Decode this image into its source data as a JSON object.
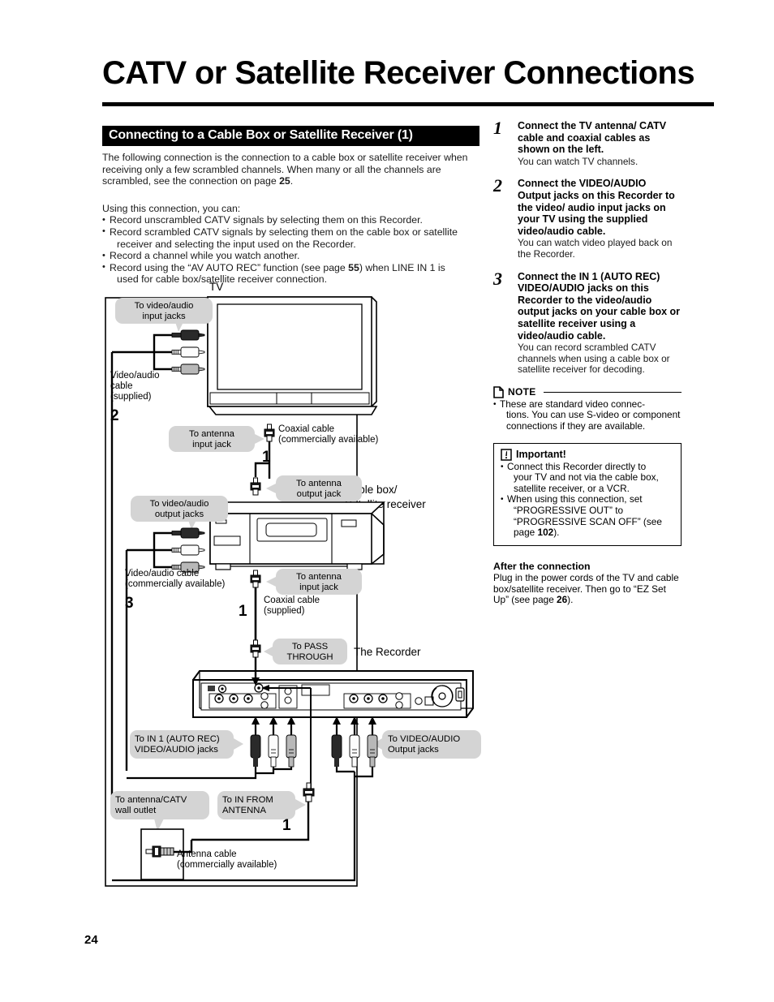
{
  "document": {
    "title": "CATV or Satellite Receiver Connections",
    "page_number": "24"
  },
  "section": {
    "heading": "Connecting to a Cable Box or Satellite Receiver (1)",
    "intro_1": "The following connection is the connection to a cable box or satellite receiver when receiving only a few scrambled channels. When many or all the channels are scrambled, see the connection on page ",
    "intro_1_page": "25",
    "intro_1_end": ".",
    "using_lead": "Using this connection, you can:",
    "bullets": [
      {
        "text": "Record unscrambled CATV signals by selecting them on this Recorder."
      },
      {
        "text": "Record scrambled CATV signals by selecting them on the cable box or satellite",
        "cont": "receiver and selecting the input used on the Recorder."
      },
      {
        "text": "Record a channel while you watch another."
      },
      {
        "pre": "Record using the “AV AUTO REC” function (see page ",
        "bold": "55",
        "post": ") when LINE IN 1 is",
        "cont": "used for cable box/satellite receiver connection."
      }
    ]
  },
  "steps": [
    {
      "number": "1",
      "heading": "Connect the TV antenna/ CATV cable and coaxial cables as shown on the left.",
      "sub": "You can watch TV channels."
    },
    {
      "number": "2",
      "heading": "Connect the VIDEO/AUDIO Output jacks on this Recorder to the video/ audio input jacks on your TV using the supplied video/audio cable.",
      "sub": "You can watch video played back on the Recorder."
    },
    {
      "number": "3",
      "heading": "Connect the IN 1 (AUTO REC) VIDEO/AUDIO jacks on this Recorder to the video/audio output jacks on your cable box or satellite receiver using a video/audio cable.",
      "sub": "You can record scrambled CATV channels when using a cable box or satellite receiver for decoding."
    }
  ],
  "note": {
    "label": "NOTE",
    "icon": "document-icon",
    "bullets": [
      {
        "text": "These are standard video connec-",
        "cont": "tions. You can use S-video or component connections if they are available."
      }
    ]
  },
  "important": {
    "label": "Important!",
    "icon": "exclamation-icon",
    "bullets": [
      {
        "text": "Connect this Recorder directly to",
        "cont": "your TV and not via the cable box, satellite receiver, or a VCR."
      },
      {
        "pre": "When using this connection, set",
        "cont_pre": "“PROGRESSIVE OUT” to “PROGRESSIVE SCAN OFF” (see page ",
        "bold": "102",
        "post": ")."
      }
    ]
  },
  "after": {
    "heading": "After the connection",
    "body_pre": "Plug in the power cords of the TV and cable box/satellite receiver. Then go to “EZ Set Up” (see page ",
    "body_bold": "26",
    "body_post": ")."
  },
  "diagram": {
    "devices": {
      "tv": "TV",
      "cable_box": "Cable box/",
      "cable_box_2": "Satellite receiver",
      "recorder": "The Recorder"
    },
    "callouts": {
      "tv_av_in_1": "To video/audio",
      "tv_av_in_2": "input jacks",
      "tv_ant_in_1": "To antenna",
      "tv_ant_in_2": "input jack",
      "box_ant_out_1": "To antenna",
      "box_ant_out_2": "output jack",
      "box_av_out_1": "To video/audio",
      "box_av_out_2": "output jacks",
      "box_ant_in_1": "To antenna",
      "box_ant_in_2": "input jack",
      "pass_through_1": "To PASS",
      "pass_through_2": "THROUGH",
      "rec_in1_1": "To IN 1 (AUTO REC)",
      "rec_in1_2": "VIDEO/AUDIO jacks",
      "rec_out_1": "To VIDEO/AUDIO",
      "rec_out_2": "Output jacks",
      "wall_1": "To antenna/CATV",
      "wall_2": "wall outlet",
      "in_from_ant_1": "To IN FROM",
      "in_from_ant_2": "ANTENNA"
    },
    "cable_labels": {
      "tv_av_cable_1": "Video/audio",
      "tv_av_cable_2": "cable",
      "tv_av_cable_3": "(supplied)",
      "tv_av_step": "2",
      "tv_coax_1": "Coaxial cable",
      "tv_coax_2": "(commercially available)",
      "tv_coax_step": "1",
      "box_av_cable_1": "Video/audio cable",
      "box_av_cable_2": "(commercially available)",
      "box_av_step": "3",
      "box_coax_1": "Coaxial cable",
      "box_coax_2": "(supplied)",
      "box_coax_step": "1",
      "ant_cable_1": "Antenna cable",
      "ant_cable_2": "(commercially available)",
      "ant_step": "1"
    },
    "colors": {
      "plug_video": "#1a1a1a",
      "plug_audio_l": "#ffffff",
      "plug_audio_r": "#b8b8b8",
      "callout_bg": "#d4d4d4",
      "line": "#000000"
    }
  }
}
